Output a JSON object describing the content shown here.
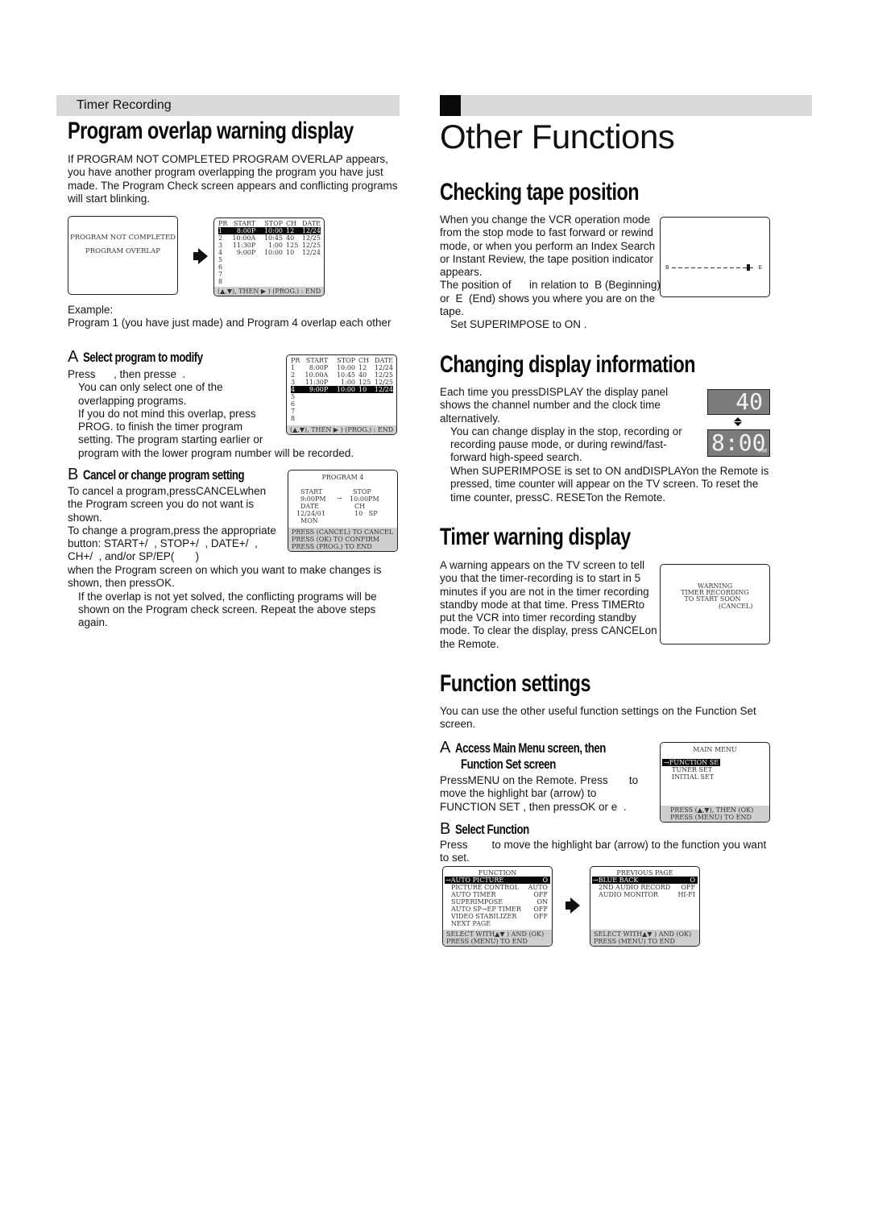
{
  "left": {
    "section_header": "Timer Recording",
    "title": "Program overlap warning display",
    "intro": "If  PROGRAM NOT COMPLETED PROGRAM OVERLAP appears, you have another program overlapping the program you have just made. The Program Check screen appears and conflicting programs will start blinking.",
    "warning_screen": {
      "line1": "PROGRAM NOT COMPLETED",
      "line2": "PROGRAM OVERLAP"
    },
    "program_check": {
      "headers": [
        "PR",
        "START",
        "STOP",
        "CH",
        "DATE"
      ],
      "rows": [
        [
          "1",
          "8:00P",
          "10:00",
          "12",
          "12/24"
        ],
        [
          "2",
          "10:00A",
          "10:45",
          "40",
          "12/25"
        ],
        [
          "3",
          "11:30P",
          "1:00",
          "125",
          "12/25"
        ],
        [
          "4",
          "9:00P",
          "10:00",
          "10",
          "12/24"
        ],
        [
          "5",
          "",
          "",
          "",
          ""
        ],
        [
          "6",
          "",
          "",
          "",
          ""
        ],
        [
          "7",
          "",
          "",
          "",
          ""
        ],
        [
          "8",
          "",
          "",
          "",
          ""
        ]
      ],
      "footer": "(▲,▼), THEN ▶ )  (PROG.) : END",
      "highlight_first": 0,
      "highlight_second": 3
    },
    "example_label": "Example:",
    "example_text": "Program 1 (you have just made) and Program 4 overlap each other",
    "step_a": {
      "letter": "A",
      "title": "Select program to modify",
      "line1": "Press      , then presse  .",
      "bullets": [
        "You can only select one of the overlapping programs.",
        "If you do not mind this overlap, press PROG. to finish the timer program setting. The program starting earlier or"
      ],
      "tail": "program with the lower program number will be recorded."
    },
    "step_b": {
      "letter": "B",
      "title": "Cancel or change program setting",
      "para1": "To cancel a program,pressCANCELwhen the Program screen you do not want is shown.",
      "para2": "To change a program,press the appropriate button: START+/  , STOP+/  , DATE+/  , CH+/  , and/or SP/EP(       )",
      "para3": "when the Program screen on which you want to make changes is shown, then pressOK.",
      "bullet": "If the overlap is not yet solved, the conflicting programs will be shown on the Program check screen. Repeat the above steps again."
    },
    "program4_screen": {
      "title": "PROGRAM 4",
      "start_label": "START",
      "stop_label": "STOP",
      "start": "9:00PM",
      "stop": "10:00PM",
      "date_label": "DATE",
      "ch_label": "CH",
      "date": "12/24/01",
      "ch": "10   SP",
      "day": "MON",
      "footer": [
        "PRESS (CANCEL) TO CANCEL",
        "PRESS (OK) TO CONFIRM",
        "PRESS (PROG.) TO END"
      ]
    }
  },
  "right": {
    "title": "Other Functions",
    "tape": {
      "title": "Checking tape position",
      "text": "When you change the VCR operation mode from the stop mode to fast forward or rewind mode, or when you perform an Index Search or Instant Review, the tape position indicator appears.",
      "text2": "The position of      in relation to  B (Beginning) or  E  (End) shows you where you are on the tape.",
      "note": "Set  SUPERIMPOSE  to  ON .",
      "indicator_begin": "B",
      "indicator_end": "E",
      "position_fraction": 0.93
    },
    "display": {
      "title": "Changing display information",
      "text": "Each time you pressDISPLAY the display panel shows the channel number and the clock time alternatively.",
      "bullet1": "You can change display in the stop, recording or recording pause mode, or during rewind/fast-forward high-speed search.",
      "bullet2": "When  SUPERIMPOSE  is set to  ON  andDISPLAYon the Remote is pressed, time counter will appear on the TV screen. To reset the time counter, pressC. RESETon the Remote.",
      "lcd_channel": "40",
      "lcd_time": "8:00",
      "lcd_pm": "PM"
    },
    "timer_warning": {
      "title": "Timer warning display",
      "text": "A warning appears on the TV screen to tell you that the timer-recording is to start in 5 minutes if you are not in the timer recording standby mode at that time. Press TIMERto put the VCR into timer recording standby mode. To clear the display, press CANCELon the Remote.",
      "screen": [
        "WARNING",
        "TIMER RECORDING",
        "TO START SOON",
        "(CANCEL)"
      ]
    },
    "function_settings": {
      "title": "Function settings",
      "intro": "You can use the other useful function settings on the Function Set screen.",
      "step_a": {
        "letter": "A",
        "title1": "Access Main Menu screen, then",
        "title2": "Function Set screen",
        "text": "PressMENU on the Remote. Press       to move the highlight bar (arrow) to  FUNCTION SET , then pressOK or e  ."
      },
      "main_menu": {
        "title": "MAIN MENU",
        "items": [
          "→FUNCTION SE",
          "TUNER SET",
          "INITIAL SET"
        ],
        "footer": [
          "PRESS (▲,▼), THEN (OK)",
          "PRESS (MENU) TO END"
        ]
      },
      "step_b": {
        "letter": "B",
        "title": "Select Function",
        "text": "Press        to move the highlight bar (arrow) to the function you want to set."
      },
      "function_screen": {
        "title": "FUNCTION",
        "items": [
          [
            "→AUTO PICTURE",
            "O"
          ],
          [
            "PICTURE CONTROL",
            "AUTO"
          ],
          [
            "AUTO TIMER",
            "OFF"
          ],
          [
            "SUPERIMPOSE",
            "ON"
          ],
          [
            "AUTO SP→EP TIMER",
            "OFF"
          ],
          [
            "VIDEO STABILIZER",
            "OFF"
          ],
          [
            "NEXT PAGE",
            ""
          ]
        ],
        "footer": [
          "SELECT WITH▲▼  ) AND (OK)",
          "PRESS (MENU) TO END"
        ]
      },
      "function_screen2": {
        "title": "PREVIOUS PAGE",
        "items": [
          [
            "→BLUE BACK",
            "O"
          ],
          [
            "2ND AUDIO RECORD",
            "OFF"
          ],
          [
            "AUDIO MONITOR",
            "HI-FI"
          ]
        ],
        "footer": [
          "SELECT WITH▲▼   ) AND (OK)",
          "PRESS (MENU) TO END"
        ]
      }
    }
  }
}
